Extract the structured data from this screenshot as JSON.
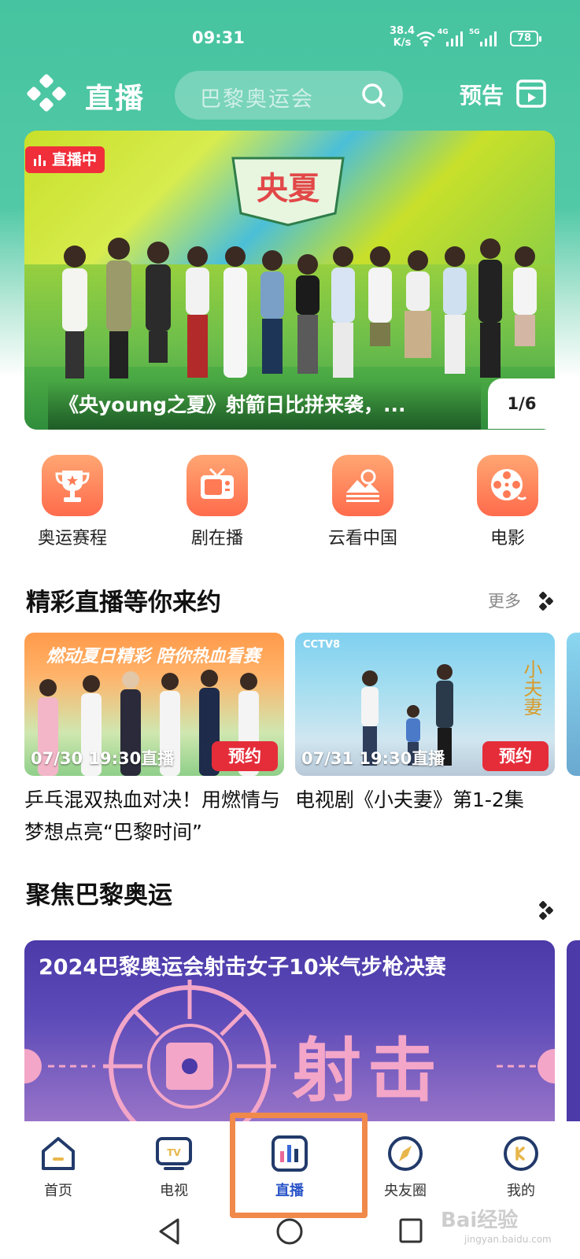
{
  "status_bar": {
    "time": "09:31",
    "speed_value": "38.4",
    "speed_unit": "K/s",
    "net1": "4G",
    "net2": "5G",
    "battery": "78"
  },
  "header": {
    "title": "直播",
    "search_placeholder": "巴黎奥运会",
    "preview_label": "预告"
  },
  "hero": {
    "live_badge": "直播中",
    "caption": "《央young之夏》射箭日比拼来袭，...",
    "pager": "1/6"
  },
  "quick_links": [
    {
      "label": "奥运赛程",
      "icon": "trophy-icon"
    },
    {
      "label": "剧在播",
      "icon": "tv-icon"
    },
    {
      "label": "云看中国",
      "icon": "landscape-icon"
    },
    {
      "label": "电影",
      "icon": "film-reel-icon"
    }
  ],
  "section_live": {
    "title": "精彩直播等你来约",
    "more_label": "更多",
    "cards": [
      {
        "time": "07/30 19:30直播",
        "reserve": "预约",
        "title": "乒乓混双热血对决！用燃情与梦想点亮“巴黎时间”",
        "banner_text": "燃动夏日精彩 陪你热血看赛"
      },
      {
        "time": "07/31 19:30直播",
        "reserve": "预约",
        "title": "电视剧《小夫妻》第1-2集",
        "channel": "CCTV8"
      }
    ]
  },
  "section_focus": {
    "title": "聚焦巴黎奥运",
    "banner_title": "2024巴黎奥运会射击女子10米气步枪决赛",
    "banner_art": "射击"
  },
  "bottom_nav": [
    {
      "label": "首页",
      "icon": "home-icon"
    },
    {
      "label": "电视",
      "icon": "tv-nav-icon"
    },
    {
      "label": "直播",
      "icon": "live-icon",
      "active": true
    },
    {
      "label": "央友圈",
      "icon": "compass-icon"
    },
    {
      "label": "我的",
      "icon": "profile-icon"
    }
  ],
  "watermark": {
    "text": "Bai经验",
    "sub": "jingyan.baidu.com"
  },
  "colors": {
    "header_green": "#4fc7a4",
    "live_red": "#f02f3b",
    "reserve_red": "#e52d3a",
    "tile_orange": "#ff7b55",
    "active_blue": "#2a55c8",
    "highlight_orange": "#f0894a"
  }
}
